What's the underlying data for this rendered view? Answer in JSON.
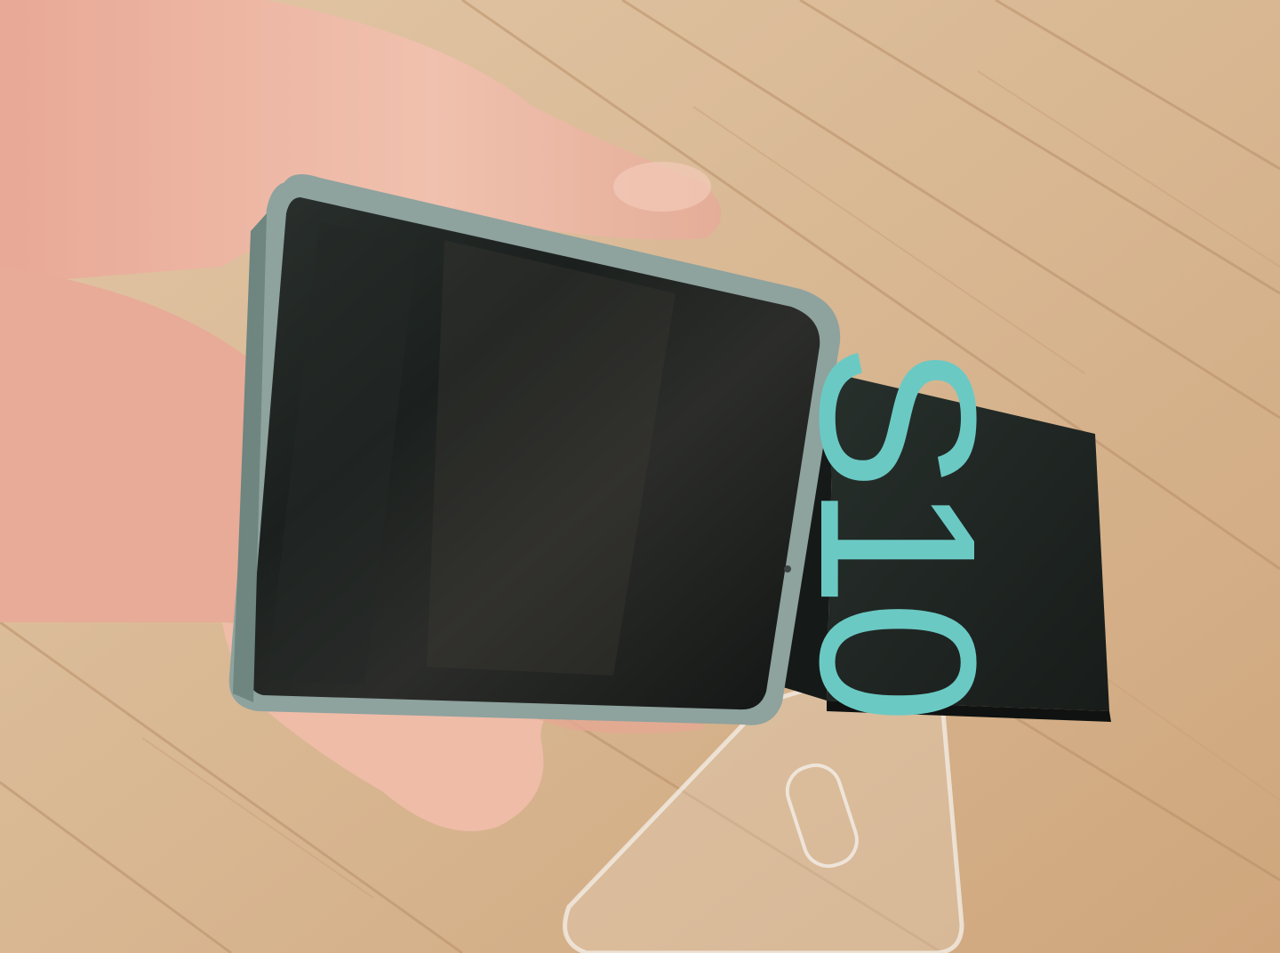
{
  "box": {
    "model_label": "S10"
  },
  "colors": {
    "floor": "#d9b894",
    "floor_dark": "#b98f68",
    "box": "#1f2522",
    "box_text": "#6bc9c4",
    "phone_screen": "#171b1a",
    "phone_frame": "#8fa3a0",
    "skin": "#e9b3a0"
  },
  "icons": {
    "subject": "smartphone-in-hand",
    "box": "product-box",
    "case": "clear-phone-case"
  }
}
